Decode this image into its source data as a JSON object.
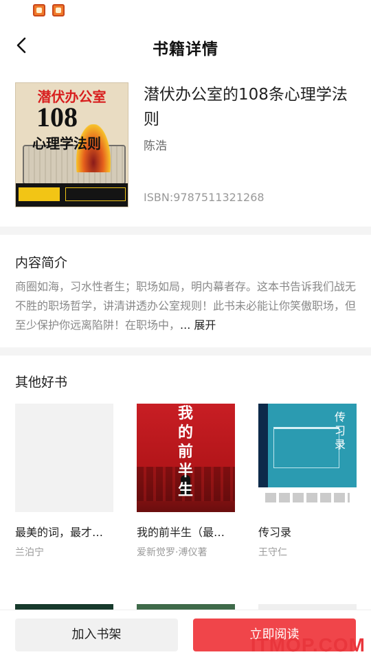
{
  "header": {
    "title": "书籍详情",
    "back_icon": "chevron-left-icon"
  },
  "book": {
    "cover": {
      "top_title": "潜伏办公室",
      "number": "108",
      "subtitle": "心理学法则"
    },
    "title": "潜伏办公室的108条心理学法则",
    "author": "陈浩",
    "isbn": "ISBN:9787511321268"
  },
  "intro": {
    "heading": "内容简介",
    "text": "商圈如海，习水性者生；职场如局，明内幕者存。这本书告诉我们战无不胜的职场哲学，讲清讲透办公室规则！此书未必能让你笑傲职场，但至少保护你远离陷阱！在职场中，",
    "more": "... 展开"
  },
  "others": {
    "heading": "其他好书",
    "items": [
      {
        "title": "最美的词，最才…",
        "author": "兰泊宁",
        "cover_style": "blank"
      },
      {
        "title": "我的前半生（最…",
        "author": "爱新觉罗·溥仪著",
        "cover_style": "red",
        "cover_text": "我的前半生"
      },
      {
        "title": "传习录",
        "author": "王守仁",
        "cover_style": "teal",
        "cover_text": "传习录"
      }
    ]
  },
  "bottom": {
    "add_shelf": "加入书架",
    "read_now": "立即阅读"
  },
  "watermark": "ITMOP.COM",
  "colors": {
    "accent": "#f0454a",
    "divider": "#f4f4f4",
    "muted_text": "#888888"
  }
}
